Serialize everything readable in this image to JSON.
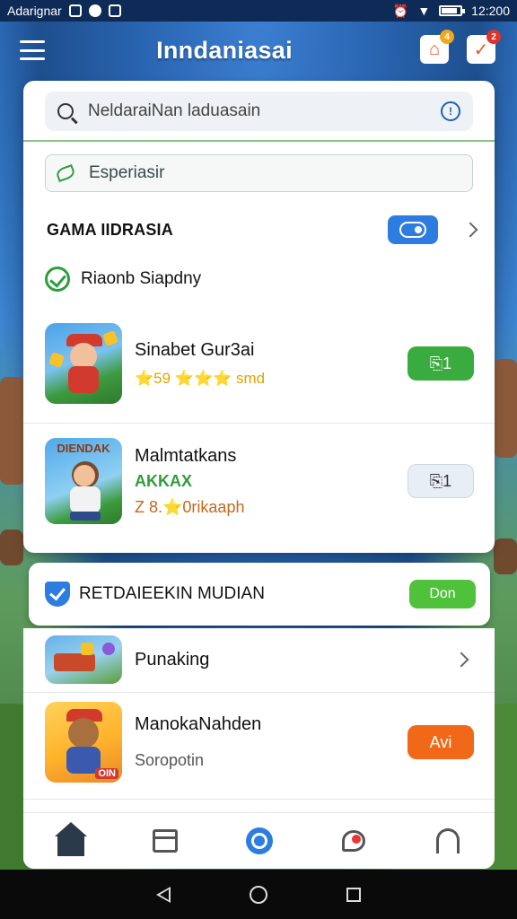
{
  "status_bar": {
    "carrier": "Adarignar",
    "time": "12:200"
  },
  "header": {
    "title": "Inndaniasai",
    "badge_home": "4",
    "badge_check": "2"
  },
  "search": {
    "placeholder": "NeldaraiNan laduasain"
  },
  "filter": {
    "text": "Esperiasir"
  },
  "section": {
    "title": "GAMA IIDRASIA"
  },
  "sub_section": {
    "title": "Riaonb Siapdny"
  },
  "apps": [
    {
      "name": "Sinabet Gur3ai",
      "meta": "⭐59 ⭐⭐⭐ smd",
      "action": "⎘1"
    },
    {
      "name": "Malmtatkans",
      "tag": "AKKAX",
      "meta": "Z 8.⭐0rikaaph",
      "action": "⎘1",
      "thumb_label": "DIENDAK"
    }
  ],
  "promo": {
    "title": "RETDAIEEKIN MUDIAN",
    "button": "Don"
  },
  "list": [
    {
      "name": "Punaking"
    },
    {
      "name": "ManokaNahden",
      "sub": "Soropotin",
      "action": "Avi",
      "thumb_badge": "OIN"
    }
  ],
  "colors": {
    "accent_blue": "#2d7de0",
    "green": "#3aab3e",
    "orange": "#f06818"
  },
  "icons": {
    "menu": "hamburger-icon",
    "home_alert": "house-icon",
    "check_alert": "check-icon",
    "search": "search-icon",
    "alert": "alert-icon",
    "leaf": "leaf-icon",
    "toggle": "toggle-icon",
    "chevron": "chevron-right-icon",
    "check": "check-circle-icon",
    "shield": "shield-check-icon",
    "tab_home": "home-icon",
    "tab_store": "store-icon",
    "tab_target": "target-icon",
    "tab_chat": "chat-icon",
    "tab_support": "headset-icon"
  }
}
